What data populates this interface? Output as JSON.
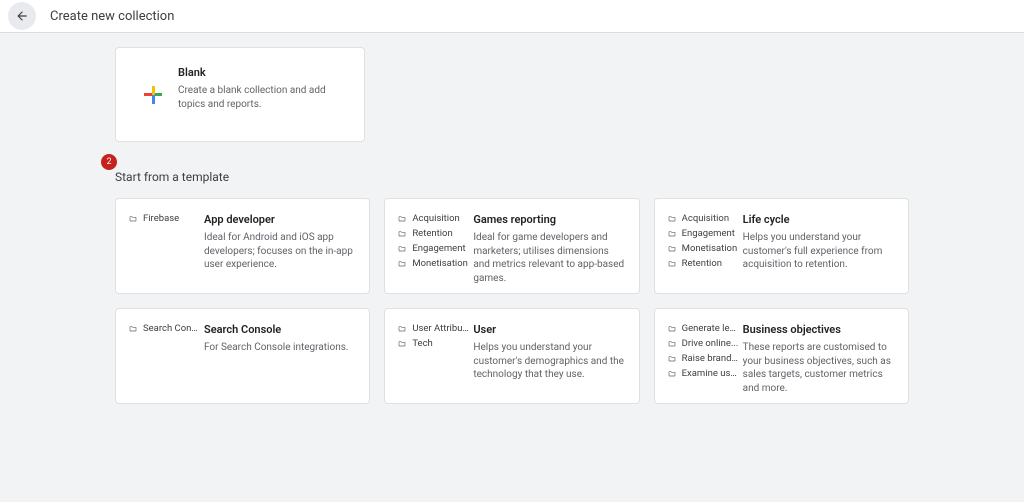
{
  "header": {
    "title": "Create new collection"
  },
  "blank": {
    "title": "Blank",
    "desc": "Create a blank collection and add topics and reports."
  },
  "section": {
    "step": "2",
    "title": "Start from a template"
  },
  "templates": [
    {
      "side": [
        "Firebase"
      ],
      "title": "App developer",
      "desc": "Ideal for Android and iOS app developers; focuses on the in-app user experience."
    },
    {
      "side": [
        "Acquisition",
        "Retention",
        "Engagement",
        "Monetisation"
      ],
      "title": "Games reporting",
      "desc": "Ideal for game developers and marketers; utilises dimensions and metrics relevant to app-based games."
    },
    {
      "side": [
        "Acquisition",
        "Engagement",
        "Monetisation",
        "Retention"
      ],
      "title": "Life cycle",
      "desc": "Helps you understand your customer's full experience from acquisition to retention."
    },
    {
      "side": [
        "Search Console"
      ],
      "title": "Search Console",
      "desc": "For Search Console integrations."
    },
    {
      "side": [
        "User Attributes",
        "Tech"
      ],
      "title": "User",
      "desc": "Helps you understand your customer's demographics and the technology that they use."
    },
    {
      "side": [
        "Generate leads",
        "Drive online...",
        "Raise brand...",
        "Examine user..."
      ],
      "title": "Business objectives",
      "desc": "These reports are customised to your business objectives, such as sales targets, customer metrics and more."
    }
  ]
}
